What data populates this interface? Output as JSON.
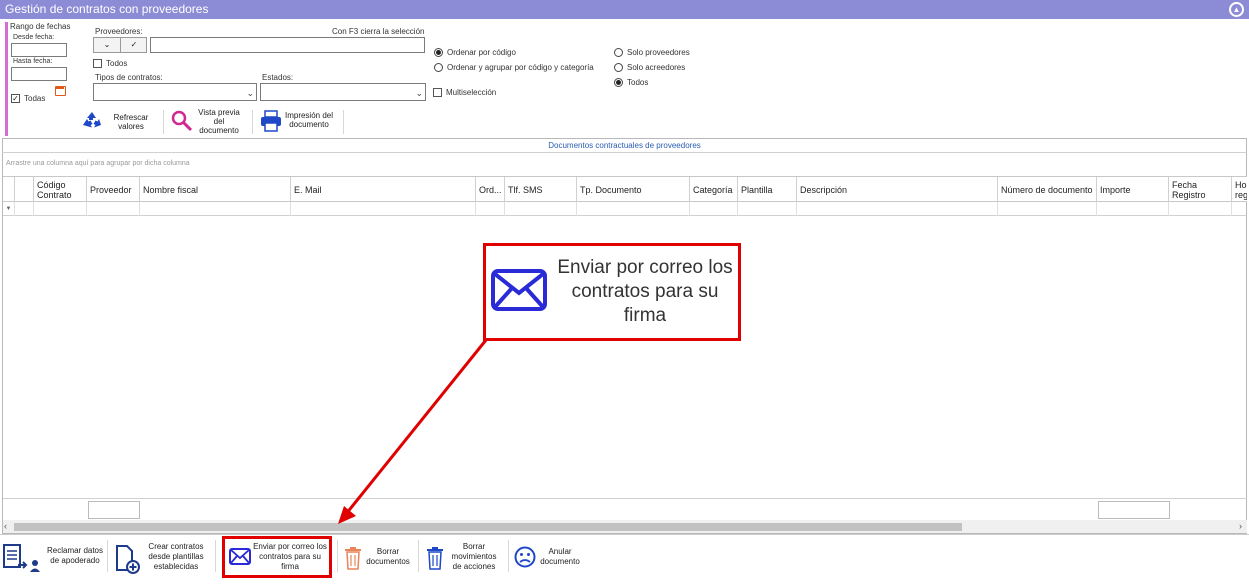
{
  "window": {
    "title": "Gestión de contratos con proveedores"
  },
  "date_range": {
    "legend": "Rango de fechas",
    "from_label": "Desde fecha:",
    "from_value": "",
    "to_label": "Hasta fecha:",
    "to_value": "",
    "all_label": "Todas",
    "all_checked": true
  },
  "suppliers": {
    "label": "Proveedores:",
    "hint": "Con F3 cierra la selección",
    "value": "",
    "all_label": "Todos",
    "all_checked": false
  },
  "contract_types": {
    "label": "Tipos de contratos:",
    "value": ""
  },
  "states": {
    "label": "Estados:",
    "value": ""
  },
  "multiselect": {
    "label": "Multiselección",
    "checked": false
  },
  "order_options": [
    {
      "label": "Ordenar por código",
      "selected": true
    },
    {
      "label": "Ordenar y agrupar por código y categoría",
      "selected": false
    }
  ],
  "party_options": [
    {
      "label": "Solo proveedores",
      "selected": false
    },
    {
      "label": "Solo acreedores",
      "selected": false
    },
    {
      "label": "Todos",
      "selected": true
    }
  ],
  "toolbar": {
    "refresh": "Refrescar valores",
    "preview": "Vista previa del documento",
    "print": "Impresión del documento"
  },
  "grid": {
    "caption": "Documentos contractuales de proveedores",
    "group_hint": "Arrastre una columna aquí para agrupar por dicha columna",
    "columns": [
      "Código Contrato",
      "Proveedor",
      "Nombre fiscal",
      "E. Mail",
      "Ord...",
      "Tlf. SMS",
      "Tp. Documento",
      "Categoría",
      "Plantilla",
      "Descripción",
      "Número de documento",
      "Importe",
      "Fecha Registro",
      "Ho reg"
    ]
  },
  "callout": {
    "text": "Enviar por correo los contratos para su firma"
  },
  "bottom_actions": [
    {
      "label": "Reclamar datos de apoderado",
      "icon": "claim-document-icon"
    },
    {
      "label": "Crear contratos desde plantillas establecidas",
      "icon": "new-document-icon"
    },
    {
      "label": "Enviar por correo los contratos para su firma",
      "icon": "envelope-icon"
    },
    {
      "label": "Borrar documentos",
      "icon": "trash-icon"
    },
    {
      "label": "Borrar movimientos de acciones",
      "icon": "trash-icon"
    },
    {
      "label": "Anular documento",
      "icon": "cancel-face-icon"
    }
  ],
  "colors": {
    "title_bar": "#8c8cd6",
    "highlight": "#e00000",
    "accent_blue": "#2a2ad6",
    "date_accent": "#d36fd3",
    "trash": "#e8845a"
  }
}
